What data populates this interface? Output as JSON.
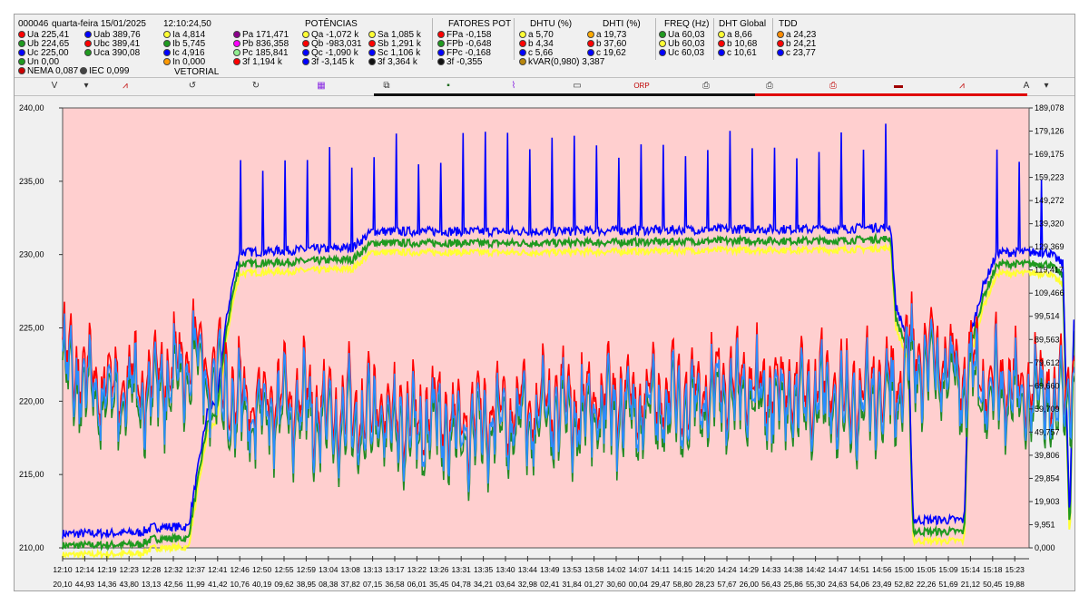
{
  "header": {
    "device": "000046",
    "date": "quarta-feira 15/01/2025",
    "time": "12:10:24,50",
    "vetorial": "VETORIAL",
    "potencias_title": "POTÊNCIAS",
    "fatores_title": "FATORES POT",
    "dhtu_title": "DHTU (%)",
    "dhti_title": "DHTI (%)",
    "freq_title": "FREQ (Hz)",
    "dhtg_title": "DHT Global",
    "tdd_title": "TDD"
  },
  "readings": {
    "ua": "Ua 225,41",
    "ub": "Ub 224,65",
    "uc": "Uc 225,00",
    "un": "Un 0,00",
    "uab": "Uab 389,76",
    "ubc": "Ubc 389,41",
    "uca": "Uca 390,08",
    "nema": "NEMA  0,087",
    "iec": "IEC  0,099",
    "ia": "Ia   4,814",
    "ib": "Ib   5,745",
    "ic": "Ic   4,916",
    "in": "In   0,000",
    "pa": "Pa  171,471",
    "pb": "Pb  836,358",
    "pc": "Pc  185,841",
    "p3f": "3f    1,194 k",
    "qa": "Qa -1,072 k",
    "qb": "Qb -983,031",
    "qc": "Qc -1,090 k",
    "q3f": "3f   -3,145 k",
    "sa": "Sa  1,085 k",
    "sb": "Sb  1,291 k",
    "sc": "Sc  1,106 k",
    "s3f": "3f    3,364 k",
    "fpa": "FPa  -0,158",
    "fpb": "FPb  -0,648",
    "fpc": "FPc  -0,168",
    "fp3f": "3f     -0,355",
    "dhtu_a": "a      5,70",
    "dhtu_b": "b      4,34",
    "dhtu_c": "c      5,66",
    "kvar": "kVAR(0,980)    3,387",
    "dhti_a": "a     19,73",
    "dhti_b": "b     37,60",
    "dhti_c": "c     19,62",
    "fua": "Ua 60,03",
    "fub": "Ub 60,03",
    "fuc": "Uc 60,03",
    "dg_a": "a    8,66",
    "dg_b": "b    10,68",
    "dg_c": "c    10,61",
    "td_a": "a    24,23",
    "td_b": "b    24,21",
    "td_c": "c    23,77"
  },
  "toolbar": {
    "items": [
      "V",
      "▾",
      "⩘",
      "↺",
      "↻",
      "▦",
      "⧉",
      "▪",
      "⌇",
      "▭",
      "ORP",
      "⎙",
      "⎙",
      "⎙",
      "▬",
      "⩘",
      "A",
      "▾"
    ]
  },
  "colors": {
    "plot_bg": "#ffcfcf",
    "ua": "#ffff33",
    "ub": "#1f9a1f",
    "uc": "#0000ff",
    "ia": "#ff0000",
    "ib": "#228b22",
    "ic": "#2a8cff"
  },
  "chart_data": {
    "type": "line",
    "ylim_left": [
      210,
      240
    ],
    "ylim_right": [
      0,
      189.078
    ],
    "y_left_ticks": [
      "240,00",
      "235,00",
      "230,00",
      "225,00",
      "220,00",
      "215,00",
      "210,00"
    ],
    "y_right_ticks": [
      "189,078",
      "179,126",
      "169,175",
      "159,223",
      "149,272",
      "139,320",
      "129,369",
      "119,417",
      "109,466",
      "99,514",
      "89,563",
      "79,612",
      "69,660",
      "59,709",
      "49,757",
      "39,806",
      "29,854",
      "19,903",
      "9,951",
      "0,000"
    ],
    "x_ticks_time": [
      "12:10",
      "12:14",
      "12:19",
      "12:23",
      "12:28",
      "12:32",
      "12:37",
      "12:41",
      "12:46",
      "12:50",
      "12:55",
      "12:59",
      "13:04",
      "13:08",
      "13:13",
      "13:17",
      "13:22",
      "13:26",
      "13:31",
      "13:35",
      "13:40",
      "13:44",
      "13:49",
      "13:53",
      "13:58",
      "14:02",
      "14:07",
      "14:11",
      "14:15",
      "14:20",
      "14:24",
      "14:29",
      "14:33",
      "14:38",
      "14:42",
      "14:47",
      "14:51",
      "14:56",
      "15:00",
      "15:05",
      "15:09",
      "15:14",
      "15:18",
      "15:23"
    ],
    "x_ticks_sec": [
      "20,10",
      "44,93",
      "14,36",
      "43,80",
      "13,13",
      "42,56",
      "11,99",
      "41,42",
      "10,76",
      "40,19",
      "09,62",
      "38,95",
      "08,38",
      "37,82",
      "07,15",
      "36,58",
      "06,01",
      "35,45",
      "04,78",
      "34,21",
      "03,64",
      "32,98",
      "02,41",
      "31,84",
      "01,27",
      "30,60",
      "00,04",
      "29,47",
      "58,80",
      "28,23",
      "57,67",
      "26,00",
      "56,43",
      "25,86",
      "55,30",
      "24,63",
      "54,06",
      "23,49",
      "52,82",
      "22,26",
      "51,69",
      "21,12",
      "50,45",
      "19,88"
    ],
    "series": [
      {
        "axis": "right",
        "level": [
          {
            "t": 0,
            "y": 2
          },
          {
            "t": 0.08,
            "y": 2.5
          },
          {
            "t": 0.095,
            "y": 5
          },
          {
            "t": 0.13,
            "y": 5
          },
          {
            "t": 0.15,
            "y": 55
          },
          {
            "t": 0.16,
            "y": 60
          },
          {
            "t": 0.168,
            "y": 90
          },
          {
            "t": 0.175,
            "y": 108
          },
          {
            "t": 0.183,
            "y": 123
          },
          {
            "t": 0.3,
            "y": 125
          },
          {
            "t": 0.32,
            "y": 132
          },
          {
            "t": 0.5,
            "y": 132
          },
          {
            "t": 0.7,
            "y": 133
          },
          {
            "t": 0.8,
            "y": 133
          },
          {
            "t": 0.857,
            "y": 134
          },
          {
            "t": 0.862,
            "y": 100
          },
          {
            "t": 0.875,
            "y": 85
          },
          {
            "t": 0.88,
            "y": 8
          },
          {
            "t": 0.933,
            "y": 8
          },
          {
            "t": 0.938,
            "y": 85
          },
          {
            "t": 0.952,
            "y": 108
          },
          {
            "t": 0.967,
            "y": 123
          },
          {
            "t": 1.02,
            "y": 123
          },
          {
            "t": 1.035,
            "y": 118
          },
          {
            "t": 1.042,
            "y": 5
          },
          {
            "t": 1.046,
            "y": 92
          },
          {
            "t": 1.055,
            "y": 95
          }
        ]
      },
      {
        "axis": "left",
        "level": [
          {
            "t": 0,
            "y": 222.5
          },
          {
            "t": 0.05,
            "y": 220
          },
          {
            "t": 0.12,
            "y": 221.5
          },
          {
            "t": 0.14,
            "y": 223
          },
          {
            "t": 0.18,
            "y": 219.5
          },
          {
            "t": 0.25,
            "y": 219.3
          },
          {
            "t": 0.35,
            "y": 218.5
          },
          {
            "t": 0.42,
            "y": 218
          },
          {
            "t": 0.5,
            "y": 219
          },
          {
            "t": 0.6,
            "y": 219.5
          },
          {
            "t": 0.7,
            "y": 220.5
          },
          {
            "t": 0.8,
            "y": 220
          },
          {
            "t": 0.86,
            "y": 220.5
          },
          {
            "t": 0.875,
            "y": 223
          },
          {
            "t": 0.93,
            "y": 221.5
          },
          {
            "t": 1,
            "y": 220.5
          },
          {
            "t": 1.04,
            "y": 220
          },
          {
            "t": 1.055,
            "y": 224
          }
        ]
      }
    ]
  }
}
